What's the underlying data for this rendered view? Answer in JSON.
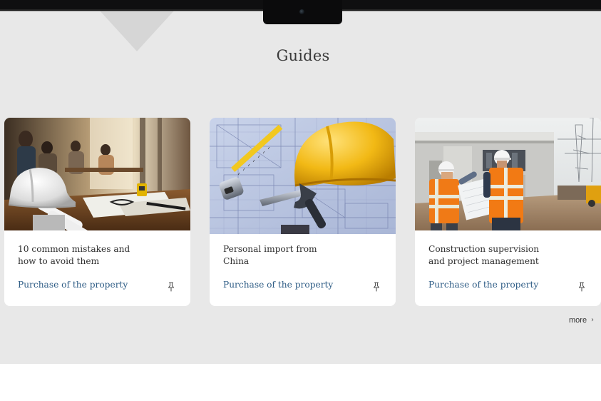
{
  "section": {
    "title": "Guides"
  },
  "cards": [
    {
      "title": "10 common mistakes and how to avoid them",
      "category": "Purchase of the property",
      "image": "office-desk-hardhat-photo",
      "pin_icon": "pin-icon"
    },
    {
      "title": "Personal import from China",
      "category": "Purchase of the property",
      "image": "blueprint-hardhat-hammer-photo",
      "pin_icon": "pin-icon"
    },
    {
      "title": "Construction supervision and project management",
      "category": "Purchase of the property",
      "image": "construction-workers-site-photo",
      "pin_icon": "pin-icon"
    }
  ],
  "more": {
    "label": "more",
    "chevron": "›"
  },
  "colors": {
    "section_bg": "#e8e8e8",
    "card_bg": "#ffffff",
    "category_link": "#2f5d86",
    "title_text": "#3a3a3a"
  }
}
